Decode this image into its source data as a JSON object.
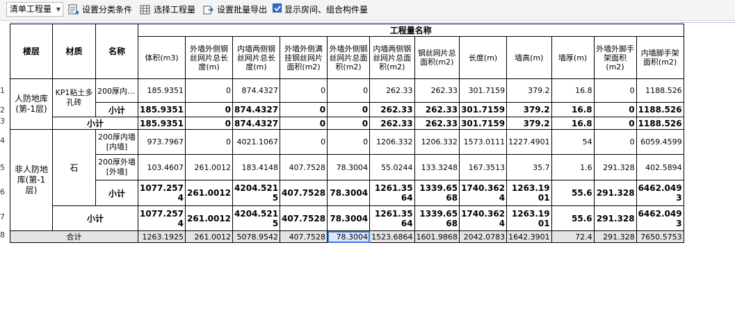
{
  "toolbar": {
    "dropdown_value": "清单工程量",
    "btn_classify": "设置分类条件",
    "btn_select": "选择工程量",
    "btn_export": "设置批量导出",
    "checkbox_label": "显示房间、组合构件量",
    "checkbox_checked": true
  },
  "table": {
    "h_floor": "楼层",
    "h_material": "材质",
    "h_name": "名称",
    "h_group": "工程量名称",
    "col_headers": [
      "体积(m3)",
      "外墙外侧钢丝网片总长度(m)",
      "内墙两侧钢丝网片总长度(m)",
      "外墙外侧满挂钢丝网片面积(m2)",
      "外墙外侧钢丝网片总面积(m2)",
      "内墙两侧钢丝网片总面积(m2)",
      "钢丝网片总面积(m2)",
      "长度(m)",
      "墙高(m)",
      "墙厚(m)",
      "外墙外脚手架面积(m2)",
      "内墙脚手架面积(m2)"
    ],
    "row_numbers": [
      "1",
      "2",
      "3",
      "4",
      "5",
      "6",
      "7",
      "8"
    ],
    "floor1": "人防地库(第-1层)",
    "floor2": "非人防地库(第-1层)",
    "mat1": "KP1粘土多孔砖",
    "mat2": "石",
    "name_r1": "200厚内…",
    "name_r4": "200厚内墙[内墙]",
    "name_r5": "200厚外墙[外墙]",
    "subtotal": "小计",
    "total": "合计",
    "r1": [
      "185.9351",
      "0",
      "874.4327",
      "0",
      "0",
      "262.33",
      "262.33",
      "301.7159",
      "379.2",
      "16.8",
      "0",
      "1188.526"
    ],
    "r2": [
      "185.9351",
      "0",
      "874.4327",
      "0",
      "0",
      "262.33",
      "262.33",
      "301.7159",
      "379.2",
      "16.8",
      "0",
      "1188.526"
    ],
    "r3": [
      "185.9351",
      "0",
      "874.4327",
      "0",
      "0",
      "262.33",
      "262.33",
      "301.7159",
      "379.2",
      "16.8",
      "0",
      "1188.526"
    ],
    "r4": [
      "973.7967",
      "0",
      "4021.1067",
      "0",
      "0",
      "1206.332",
      "1206.332",
      "1573.0111",
      "1227.4901",
      "54",
      "0",
      "6059.4599"
    ],
    "r5": [
      "103.4607",
      "261.0012",
      "183.4148",
      "407.7528",
      "78.3004",
      "55.0244",
      "133.3248",
      "167.3513",
      "35.7",
      "1.6",
      "291.328",
      "402.5894"
    ],
    "r6": [
      "1077.2574",
      "261.0012",
      "4204.5215",
      "407.7528",
      "78.3004",
      "1261.3564",
      "1339.6568",
      "1740.3624",
      "1263.1901",
      "55.6",
      "291.328",
      "6462.0493"
    ],
    "r7": [
      "1077.2574",
      "261.0012",
      "4204.5215",
      "407.7528",
      "78.3004",
      "1261.3564",
      "1339.6568",
      "1740.3624",
      "1263.1901",
      "55.6",
      "291.328",
      "6462.0493"
    ],
    "r8": [
      "1263.1925",
      "261.0012",
      "5078.9542",
      "407.7528",
      "78.3004",
      "1523.6864",
      "1601.9868",
      "2042.0783",
      "1642.3901",
      "72.4",
      "291.328",
      "7650.5753"
    ]
  }
}
